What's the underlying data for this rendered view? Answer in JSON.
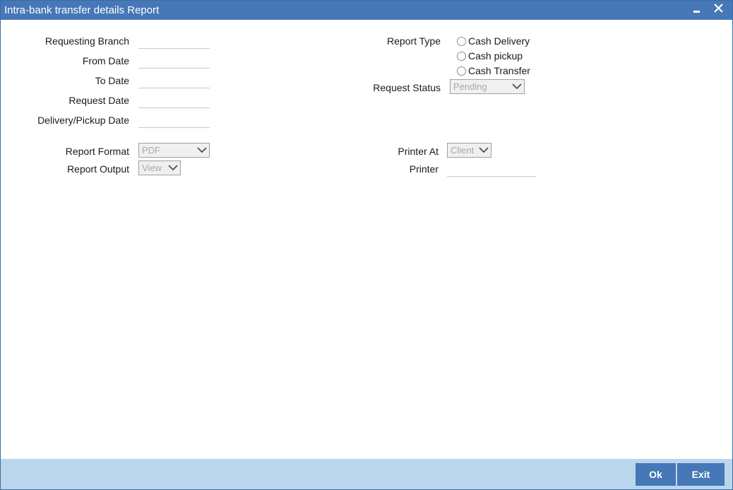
{
  "window": {
    "title": "Intra-bank transfer details Report",
    "minimize_icon": "minimize-icon",
    "close_icon": "close-icon"
  },
  "form": {
    "requesting_branch": {
      "label": "Requesting Branch",
      "value": ""
    },
    "from_date": {
      "label": "From Date",
      "value": ""
    },
    "to_date": {
      "label": "To Date",
      "value": ""
    },
    "request_date": {
      "label": "Request Date",
      "value": ""
    },
    "delivery_pickup_date": {
      "label": "Delivery/Pickup Date",
      "value": ""
    },
    "report_type": {
      "label": "Report Type",
      "options": [
        "Cash Delivery",
        "Cash pickup",
        "Cash Transfer"
      ],
      "selected": null
    },
    "request_status": {
      "label": "Request Status",
      "value": "Pending"
    },
    "report_format": {
      "label": "Report Format",
      "value": "PDF"
    },
    "report_output": {
      "label": "Report Output",
      "value": "View"
    },
    "printer_at": {
      "label": "Printer At",
      "value": "Client"
    },
    "printer": {
      "label": "Printer",
      "value": ""
    }
  },
  "footer": {
    "ok_label": "Ok",
    "exit_label": "Exit"
  },
  "colors": {
    "titlebar": "#4677b7",
    "footer": "#bad6ec",
    "button": "#4677b7"
  }
}
